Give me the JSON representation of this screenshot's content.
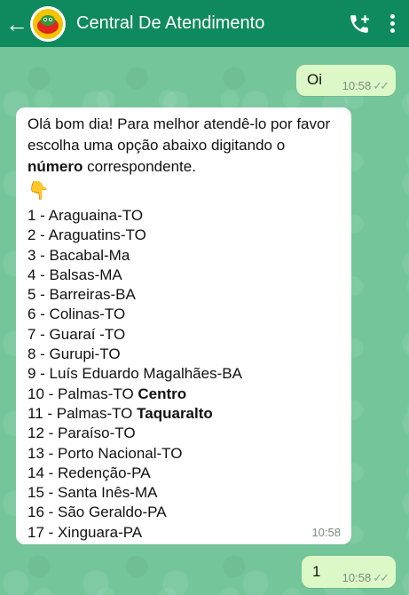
{
  "header": {
    "title": "Central De Atendimento",
    "back_icon": "arrow-left-icon",
    "avatar_icon": "logo-avatar",
    "call_icon": "add-call-icon",
    "menu_icon": "more-vert-icon",
    "colors": {
      "bar": "#0f8a5f",
      "text": "#ffffff"
    }
  },
  "messages": {
    "first_out": {
      "text": "Oi",
      "time": "10:58",
      "status": "read"
    },
    "incoming": {
      "intro_1": "Olá bom dia! Para melhor atendê-lo por favor escolha uma opção abaixo digitando o ",
      "intro_bold": "número",
      "intro_2": " correspondente.",
      "emoji": "👇",
      "options": [
        {
          "text": "1 - Araguaina-TO",
          "bold": ""
        },
        {
          "text": "2 - Araguatins-TO",
          "bold": ""
        },
        {
          "text": "3 - Bacabal-Ma",
          "bold": ""
        },
        {
          "text": "4 - Balsas-MA",
          "bold": ""
        },
        {
          "text": "5 - Barreiras-BA",
          "bold": ""
        },
        {
          "text": "6 - Colinas-TO",
          "bold": ""
        },
        {
          "text": "7 - Guaraí -TO",
          "bold": ""
        },
        {
          "text": "8 - Gurupi-TO",
          "bold": ""
        },
        {
          "text": "9 - Luís Eduardo Magalhães-BA",
          "bold": ""
        },
        {
          "text": "10 - Palmas-TO ",
          "bold": "Centro"
        },
        {
          "text": "11 - Palmas-TO ",
          "bold": "Taquaralto"
        },
        {
          "text": "12 - Paraíso-TO",
          "bold": ""
        },
        {
          "text": "13 - Porto Nacional-TO",
          "bold": ""
        },
        {
          "text": "14 - Redenção-PA",
          "bold": ""
        },
        {
          "text": "15 - Santa Inês-MA",
          "bold": ""
        },
        {
          "text": "16 - São Geraldo-PA",
          "bold": ""
        },
        {
          "text": "17 - Xinguara-PA",
          "bold": ""
        }
      ],
      "time": "10:58"
    },
    "second_out": {
      "text": "1",
      "time": "10:58",
      "status": "read"
    }
  },
  "colors": {
    "outgoing_bubble": "#dcf8c6",
    "incoming_bubble": "#ffffff",
    "chat_background": "#74c69a",
    "read_ticks": "#8fa29a"
  }
}
